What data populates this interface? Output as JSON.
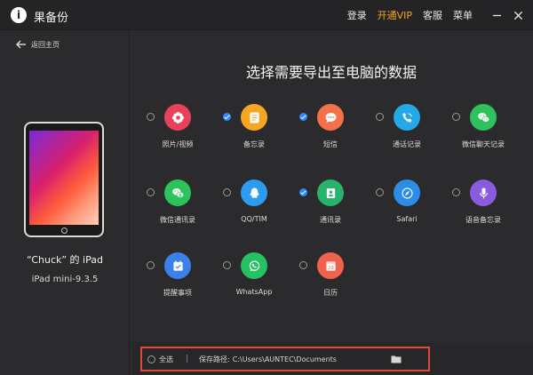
{
  "app": {
    "logo_glyph": "i",
    "title": "果备份"
  },
  "topnav": {
    "login": "登录",
    "vip": "开通VIP",
    "support": "客服",
    "menu": "菜单"
  },
  "colors": {
    "accent": "#2f88ff",
    "vip": "#f5a623",
    "highlight_border": "#e04a3f"
  },
  "sidebar": {
    "back_label": "返回主页",
    "device_name": "“Chuck” 的 iPad",
    "device_model": "iPad mini-9.3.5"
  },
  "main": {
    "title": "选择需要导出至电脑的数据",
    "items": [
      {
        "label": "照片/视频",
        "checked": false,
        "icon": "photos-icon"
      },
      {
        "label": "备忘录",
        "checked": true,
        "icon": "notes-icon"
      },
      {
        "label": "短信",
        "checked": true,
        "icon": "messages-icon"
      },
      {
        "label": "通话记录",
        "checked": false,
        "icon": "call-log-icon"
      },
      {
        "label": "微信聊天记录",
        "checked": false,
        "icon": "wechat-chat-icon"
      },
      {
        "label": "微信通讯录",
        "checked": false,
        "icon": "wechat-contacts-icon"
      },
      {
        "label": "QQ/TIM",
        "checked": false,
        "icon": "qq-icon"
      },
      {
        "label": "通讯录",
        "checked": true,
        "icon": "contacts-icon"
      },
      {
        "label": "Safari",
        "checked": false,
        "icon": "safari-icon"
      },
      {
        "label": "语音备忘录",
        "checked": false,
        "icon": "voice-memo-icon"
      },
      {
        "label": "提醒事项",
        "checked": false,
        "icon": "reminders-icon"
      },
      {
        "label": "WhatsApp",
        "checked": false,
        "icon": "whatsapp-icon"
      },
      {
        "label": "日历",
        "checked": false,
        "icon": "calendar-icon"
      }
    ]
  },
  "footer": {
    "select_all": "全选",
    "separator": "|",
    "save_path_label": "保存路径:",
    "save_path": "C:\\Users\\AUNTEC\\Documents"
  }
}
